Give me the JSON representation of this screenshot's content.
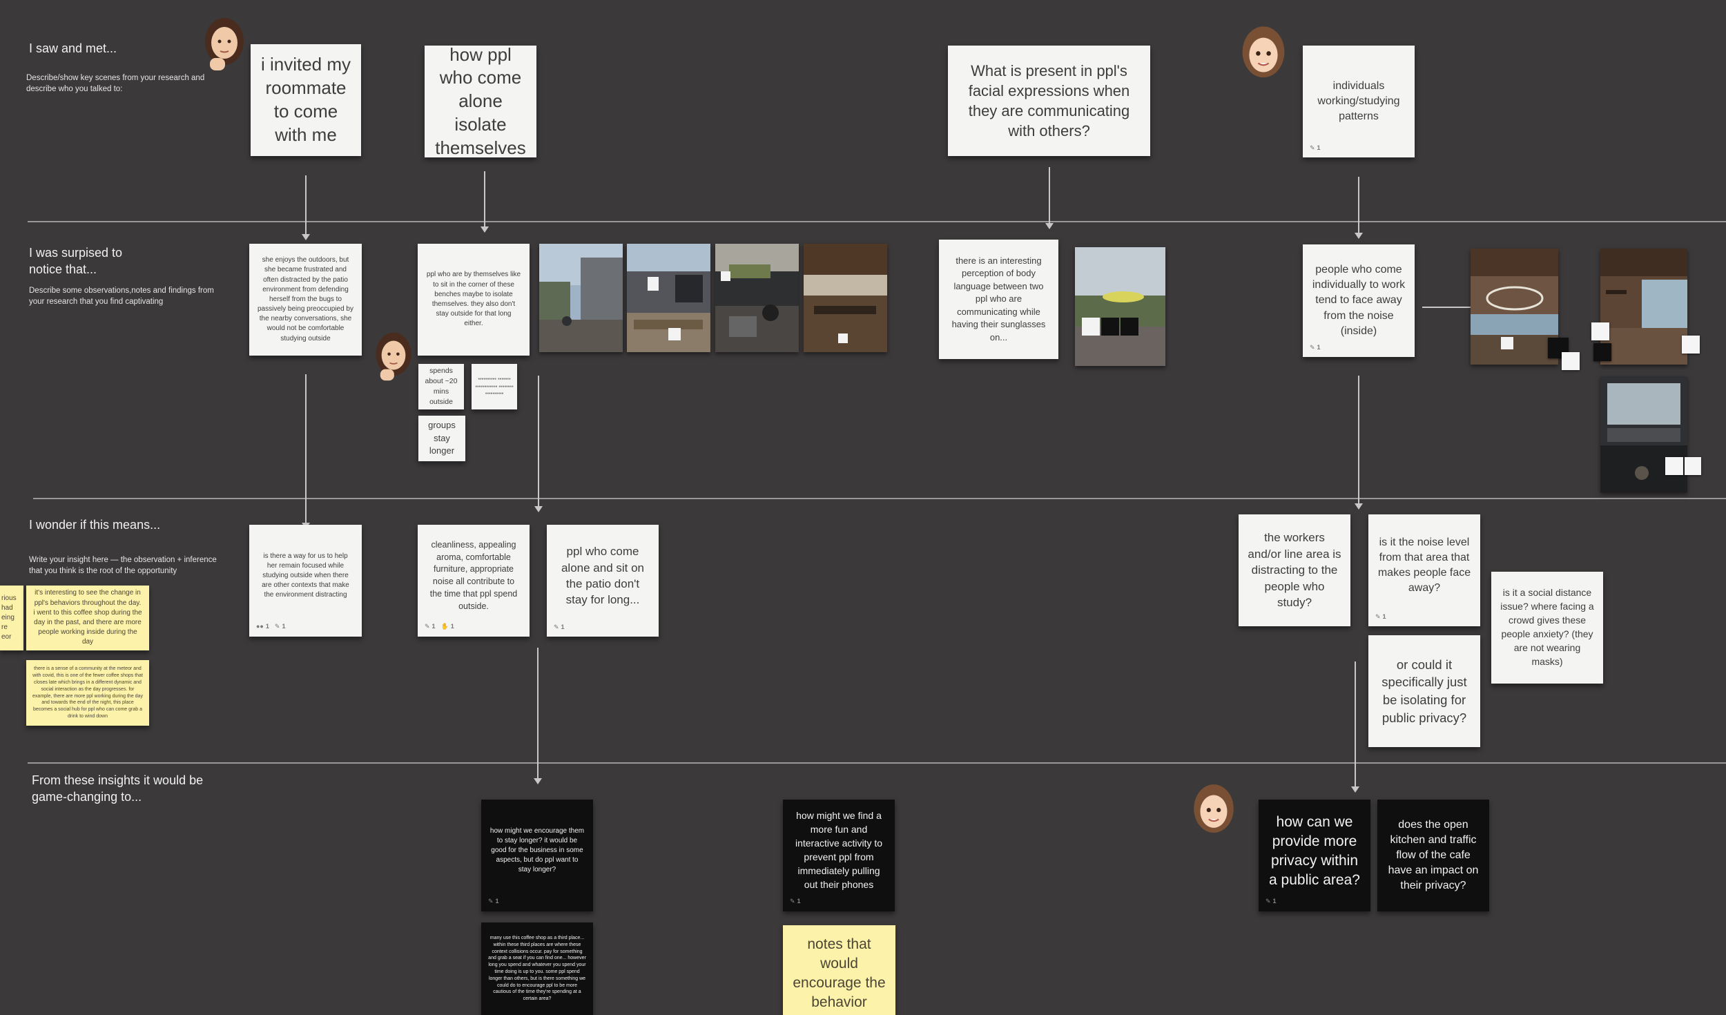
{
  "sections": {
    "saw": {
      "title": "I saw and met...",
      "desc": "Describe/show key scenes from your research and describe who you talked to:"
    },
    "surprised": {
      "title": "I was surpised to notice that...",
      "desc": "Describe some observations,notes and findings from your research that you find captivating"
    },
    "wonder": {
      "title": "I wonder if this means...",
      "desc": "Write your insight here — the observation + inference that you think is the root of the opportunity"
    },
    "game": {
      "title": "From these insights it would be game-changing to..."
    }
  },
  "notes": {
    "n1": "i invited my roommate to come with me",
    "n2": "how ppl who come alone isolate themselves",
    "n3": "What is present in ppl's facial expressions when they are communicating with others?",
    "n4": "individuals working/studying patterns",
    "n5": "she enjoys the outdoors, but she became frustrated and often distracted by the patio environment from defending herself from the bugs to passively being preoccupied by the nearby conversations, she would not be comfortable studying outside",
    "n6": "ppl who are by themselves like to sit in the corner of these benches maybe to isolate themselves. they also don't stay outside for that long either.",
    "n7": "spends about ~20 mins outside",
    "n8": "groups stay longer",
    "n9": "there is an interesting perception of body language between two ppl who are communicating while having their sunglasses on...",
    "n10": "people who come individually to work tend to face away from the noise (inside)",
    "n11": "is there a way for us to help her remain focused while studying outside when there are other contexts that make the environment distracting",
    "n12": "cleanliness, appealing aroma, comfortable furniture, appropriate noise all contribute to the time that  ppl spend outside.",
    "n13": "ppl who come alone and sit on the patio don't stay for long...",
    "n14": "the workers and/or line area is distracting to the people who study?",
    "n15": "is it the noise level from that area that makes people face away?",
    "n16": "or could it specifically just be isolating for public privacy?",
    "n17": "is it a social distance issue? where facing a crowd gives these people anxiety? (they are not wearing masks)",
    "y1": "it's interesting to see the change in ppl's behaviors throughout the day. i went to this coffee shop during the day in the past, and there are more people working inside during the day",
    "y2": "there is a sense of a community at the meteor and with covid, this is one of the fewer coffee shops that closes late which brings in a different dynamic and social interaction as the day progresses. for example, there are more ppl working during the day and towards the end of the night, this place becomes a social hub for ppl who can come grab a drink to wind down",
    "yedge": "rious had eing re eor",
    "k1": "how might we encourage them to stay longer? it would be good for the business in some aspects, but do ppl want to stay longer?",
    "k2": "many use this coffee shop as a third place... within these third places are where these context collisions occur. pay for something and grab a seat if you can find one... however long you spend and whatever you spend your time doing is up to you. some ppl spend longer than others, but is there something we could do to encourage ppl to be more cautious of the time they're spending at a certain area?",
    "k3": "how might we find a more fun and interactive activity to prevent ppl from immediately pulling out their phones",
    "y3": "notes that would encourage the behavior",
    "k4": "how can we provide more privacy within a public area?",
    "k5": "does the open kitchen and traffic flow of the cafe have an impact on their privacy?"
  },
  "meta": {
    "one": "1",
    "n11_a": "1",
    "n11_b": "1",
    "n12_a": "1",
    "n12_b": "1"
  }
}
